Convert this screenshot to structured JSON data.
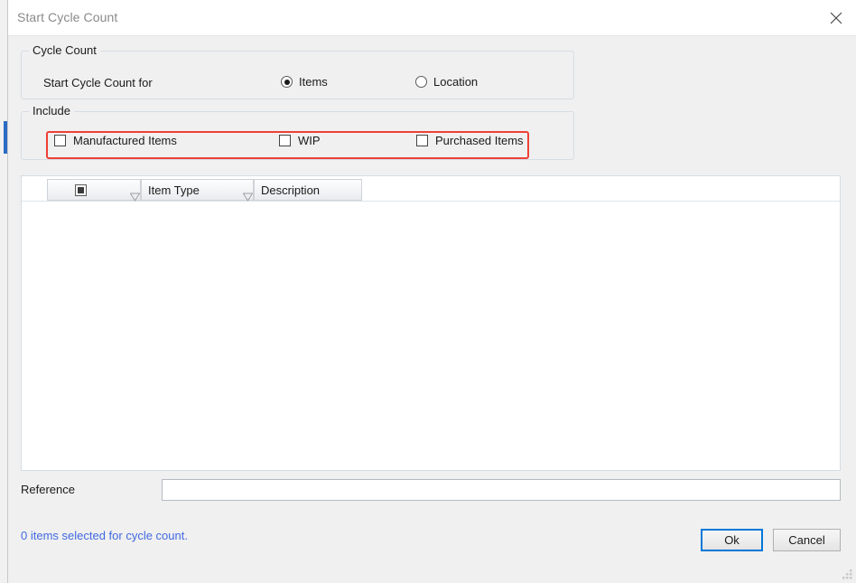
{
  "window": {
    "title": "Start Cycle Count",
    "close_icon": "close-icon",
    "resize_grip_icon": "resize-grip-icon"
  },
  "cycle_count_group": {
    "legend": "Cycle Count",
    "field_label": "Start Cycle Count for",
    "options": [
      {
        "label": "Items",
        "selected": true
      },
      {
        "label": "Location",
        "selected": false
      }
    ]
  },
  "include_group": {
    "legend": "Include",
    "options": [
      {
        "label": "Manufactured Items",
        "checked": false
      },
      {
        "label": "WIP",
        "checked": false
      },
      {
        "label": "Purchased Items",
        "checked": false
      }
    ],
    "highlight_color": "#ef4036"
  },
  "grid": {
    "columns": [
      {
        "label": "",
        "icon": "select-all-checkbox-icon",
        "filter_icon": "filter-triangle-icon"
      },
      {
        "label": "Item Type",
        "filter_icon": "filter-triangle-icon"
      },
      {
        "label": "Description"
      }
    ],
    "rows": []
  },
  "reference": {
    "label": "Reference",
    "value": "",
    "placeholder": ""
  },
  "footer": {
    "status": "0 items selected for cycle count.",
    "status_color": "#4169e1",
    "ok_label": "Ok",
    "cancel_label": "Cancel"
  }
}
